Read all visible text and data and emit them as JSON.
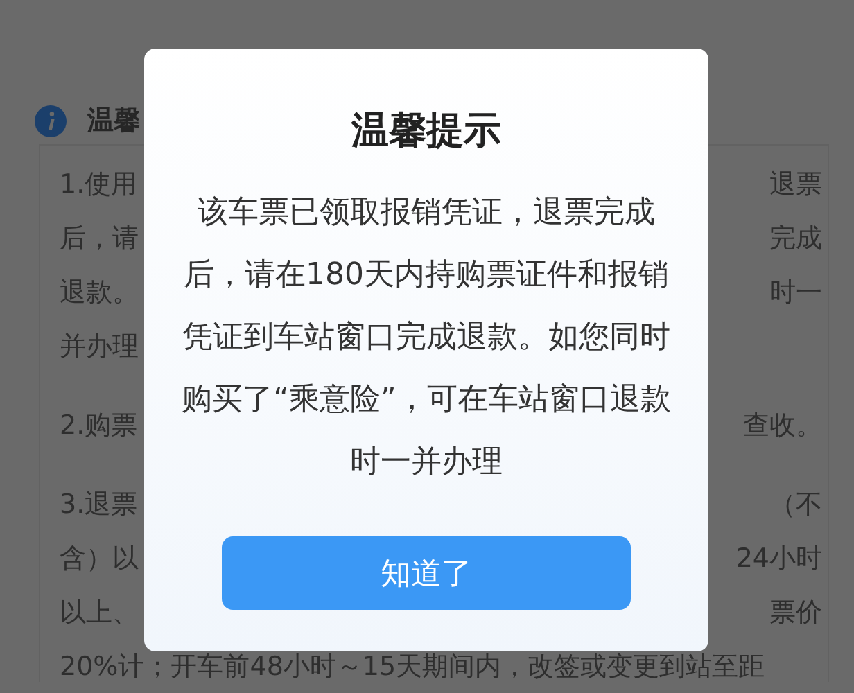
{
  "page": {
    "title": "温馨",
    "paragraphs": [
      {
        "lines": [
          {
            "left": "1.使用",
            "right": "退票"
          },
          {
            "left": "后，请",
            "right": "完成"
          },
          {
            "left": "退款。",
            "right": "时一"
          },
          {
            "left": "并办理"
          }
        ]
      },
      {
        "lines": [
          {
            "left": "2.购票",
            "right": "查收。"
          }
        ]
      },
      {
        "lines": [
          {
            "left": "3.退票",
            "right": "（不"
          },
          {
            "left": "含）以",
            "right": "24小时"
          },
          {
            "left": "以上、",
            "right": "票价"
          },
          {
            "left": "20%计；开车前48小时～15天期间内，改签或变更到站至距"
          }
        ]
      }
    ]
  },
  "dialog": {
    "title": "温馨提示",
    "message": "该车票已领取报销凭证，退票完成后，请在180天内持购票证件和报销凭证到车站窗口完成退款。如您同时购买了“乘意险”，可在车站窗口退款时一并办理",
    "button": "知道了"
  }
}
